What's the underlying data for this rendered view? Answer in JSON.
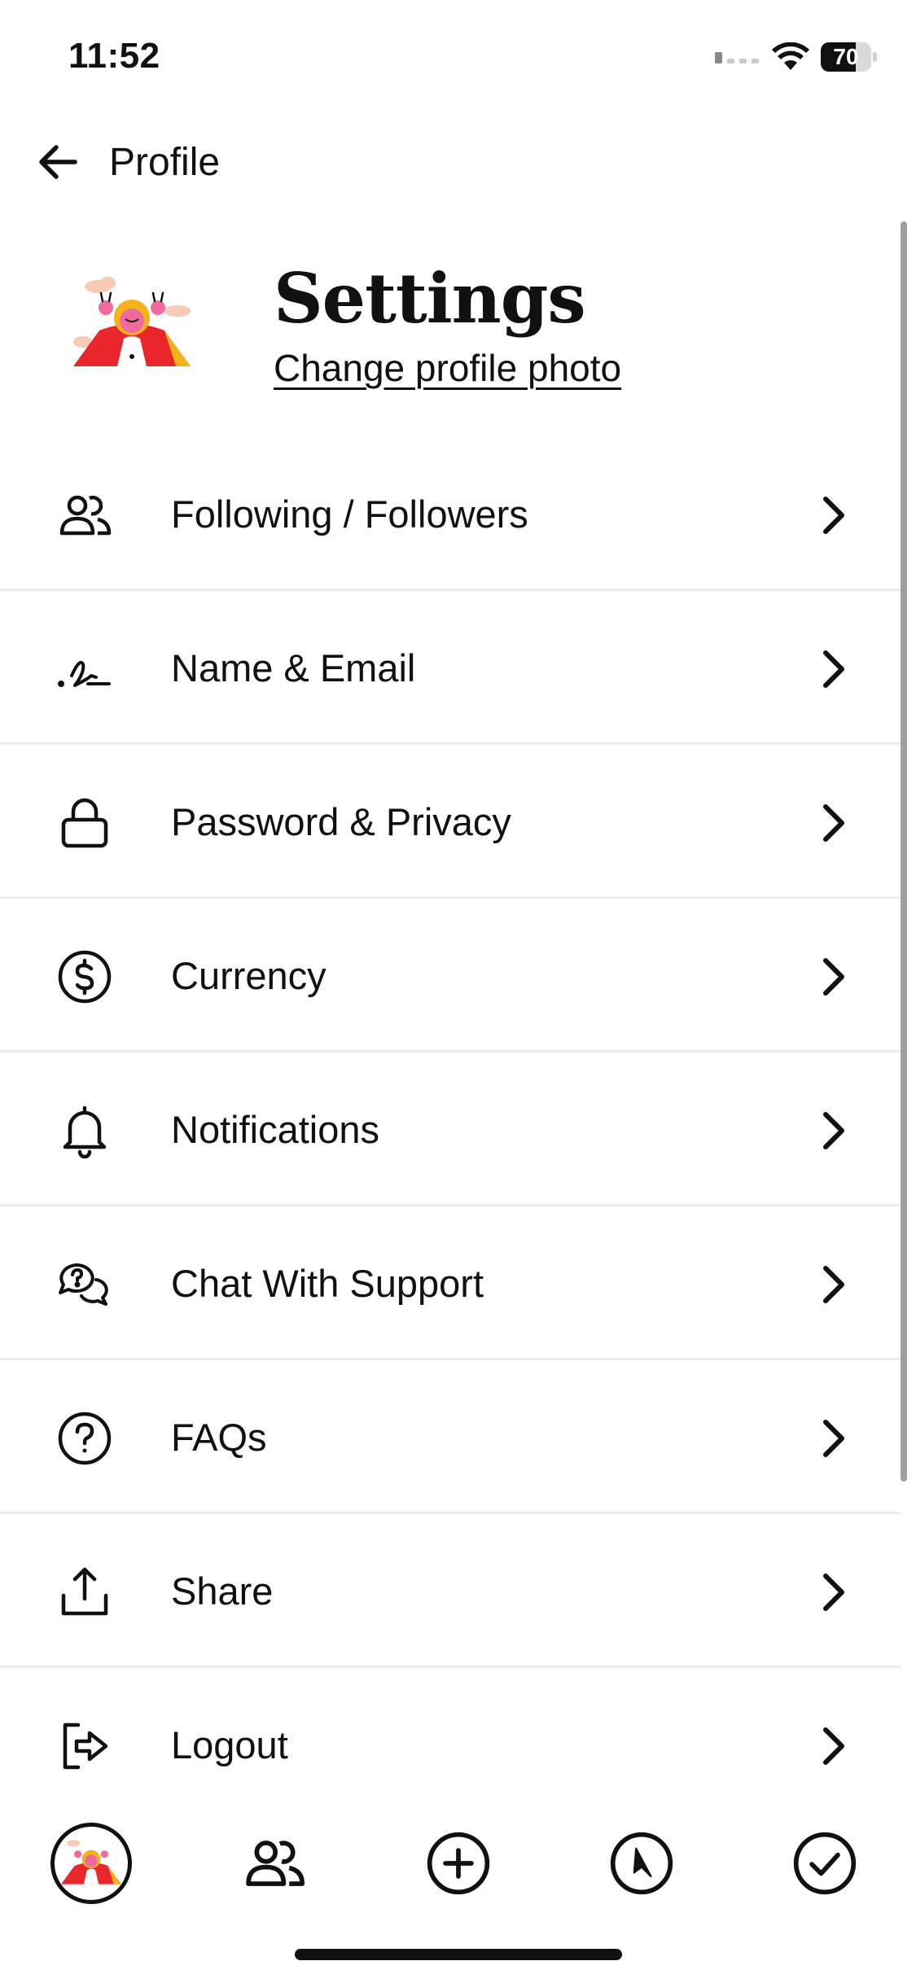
{
  "status_bar": {
    "time": "11:52",
    "battery_percent": 70,
    "battery_label": "70"
  },
  "top_bar": {
    "back_icon": "arrow-left-icon",
    "title": "Profile"
  },
  "header": {
    "title": "Settings",
    "change_photo_label": "Change profile photo"
  },
  "menu": {
    "items": [
      {
        "label": "Following / Followers",
        "icon": "people-icon"
      },
      {
        "label": "Name & Email",
        "icon": "signature-icon"
      },
      {
        "label": "Password & Privacy",
        "icon": "lock-icon"
      },
      {
        "label": "Currency",
        "icon": "dollar-circle-icon"
      },
      {
        "label": "Notifications",
        "icon": "bell-icon"
      },
      {
        "label": "Chat With Support",
        "icon": "chat-bubbles-icon"
      },
      {
        "label": "FAQs",
        "icon": "question-circle-icon"
      },
      {
        "label": "Share",
        "icon": "share-upload-icon"
      },
      {
        "label": "Logout",
        "icon": "logout-icon"
      }
    ]
  },
  "tab_bar": {
    "tabs": [
      {
        "icon": "profile-avatar-icon",
        "active": true
      },
      {
        "icon": "people-icon"
      },
      {
        "icon": "plus-circle-icon"
      },
      {
        "icon": "compass-icon"
      },
      {
        "icon": "check-circle-icon"
      }
    ]
  },
  "colors": {
    "text": "#111111",
    "divider": "#ececec",
    "avatar_red": "#e8262c",
    "avatar_pink": "#f06aa0",
    "avatar_yellow": "#f6b21a"
  }
}
